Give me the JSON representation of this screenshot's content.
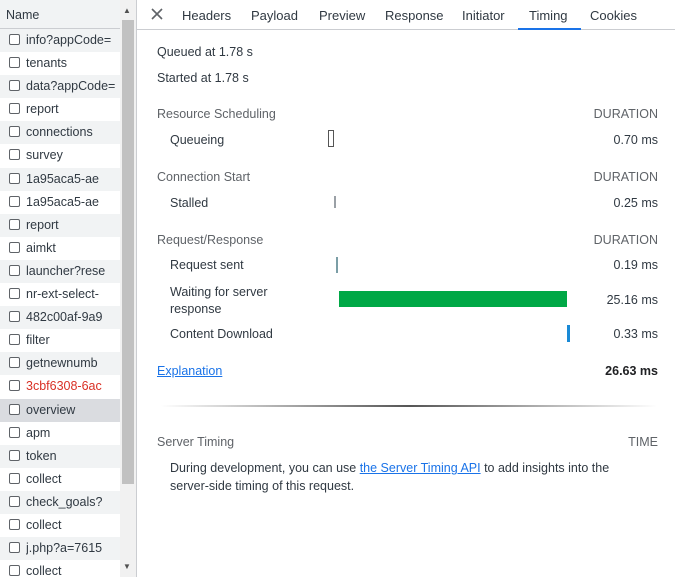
{
  "list": {
    "header": "Name",
    "items": [
      {
        "name": "info?appCode=",
        "error": false
      },
      {
        "name": "tenants",
        "error": false
      },
      {
        "name": "data?appCode=",
        "error": false
      },
      {
        "name": "report",
        "error": false
      },
      {
        "name": "connections",
        "error": false
      },
      {
        "name": "survey",
        "error": false
      },
      {
        "name": "1a95aca5-ae",
        "error": false
      },
      {
        "name": "1a95aca5-ae",
        "error": false
      },
      {
        "name": "report",
        "error": false
      },
      {
        "name": "aimkt",
        "error": false
      },
      {
        "name": "launcher?rese",
        "error": false
      },
      {
        "name": "nr-ext-select-",
        "error": false
      },
      {
        "name": "482c00af-9a9",
        "error": false
      },
      {
        "name": "filter",
        "error": false
      },
      {
        "name": "getnewnumb",
        "error": false
      },
      {
        "name": "3cbf6308-6ac",
        "error": true
      },
      {
        "name": "overview",
        "error": false,
        "selected": true
      },
      {
        "name": "apm",
        "error": false
      },
      {
        "name": "token",
        "error": false
      },
      {
        "name": "collect",
        "error": false
      },
      {
        "name": "check_goals?",
        "error": false
      },
      {
        "name": "collect",
        "error": false
      },
      {
        "name": "j.php?a=7615",
        "error": false
      },
      {
        "name": "collect",
        "error": false
      }
    ]
  },
  "tabs": [
    "Headers",
    "Payload",
    "Preview",
    "Response",
    "Initiator",
    "Timing",
    "Cookies"
  ],
  "active_tab": "Timing",
  "timing": {
    "queued": "Queued at 1.78 s",
    "started": "Started at 1.78 s",
    "duration_label": "DURATION",
    "sections": [
      {
        "title": "Resource Scheduling",
        "rows": [
          {
            "label": "Queueing",
            "value": "0.70 ms"
          }
        ]
      },
      {
        "title": "Connection Start",
        "rows": [
          {
            "label": "Stalled",
            "value": "0.25 ms"
          }
        ]
      },
      {
        "title": "Request/Response",
        "rows": [
          {
            "label": "Request sent",
            "value": "0.19 ms"
          },
          {
            "label": "Waiting for server response",
            "value": "25.16 ms"
          },
          {
            "label": "Content Download",
            "value": "0.33 ms"
          }
        ]
      }
    ],
    "explanation": "Explanation",
    "total": "26.63 ms",
    "bar_colors": {
      "queueing": "#ffffff",
      "stalled": "#9aa0a6",
      "request_sent": "#7b9ea6",
      "waiting": "#00a846",
      "download": "#1a8ad6"
    }
  },
  "server_timing": {
    "title": "Server Timing",
    "time_label": "TIME",
    "text_before": "During development, you can use ",
    "link": "the Server Timing API",
    "text_after": " to add insights into the server-side timing of this request."
  }
}
